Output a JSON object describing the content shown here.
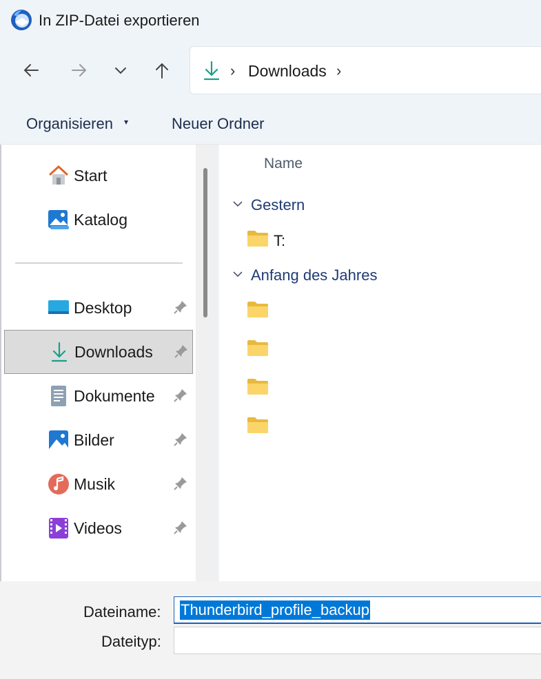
{
  "window": {
    "title": "In ZIP-Datei exportieren",
    "app_icon": "thunderbird-icon"
  },
  "nav": {
    "back": "arrow-left-icon",
    "forward": "arrow-right-icon",
    "recent": "chevron-down-icon",
    "up": "arrow-up-icon"
  },
  "address_bar": {
    "location": "Downloads"
  },
  "toolbar": {
    "organize_label": "Organisieren",
    "new_folder_label": "Neuer Ordner"
  },
  "sidebar": {
    "quick": [
      {
        "label": "Start",
        "icon": "home-icon"
      },
      {
        "label": "Katalog",
        "icon": "gallery-icon"
      }
    ],
    "pinned": [
      {
        "label": "Desktop",
        "icon": "desktop-icon",
        "selected": false
      },
      {
        "label": "Downloads",
        "icon": "download-icon",
        "selected": true
      },
      {
        "label": "Dokumente",
        "icon": "documents-icon",
        "selected": false
      },
      {
        "label": "Bilder",
        "icon": "pictures-icon",
        "selected": false
      },
      {
        "label": "Musik",
        "icon": "music-icon",
        "selected": false
      },
      {
        "label": "Videos",
        "icon": "videos-icon",
        "selected": false
      }
    ]
  },
  "file_list": {
    "column_name": "Name",
    "groups": [
      {
        "label": "Gestern",
        "items": [
          {
            "name": "T:"
          }
        ]
      },
      {
        "label": "Anfang des Jahres",
        "items": [
          {
            "name": ""
          },
          {
            "name": ""
          },
          {
            "name": ""
          },
          {
            "name": ""
          }
        ]
      }
    ]
  },
  "form": {
    "filename_label": "Dateiname:",
    "filename_value": "Thunderbird_profile_backup",
    "filetype_label": "Dateityp:",
    "filetype_value": ""
  },
  "colors": {
    "accent": "#0078d7",
    "group_text": "#1f3b73",
    "selection": "#dcdcdc"
  }
}
